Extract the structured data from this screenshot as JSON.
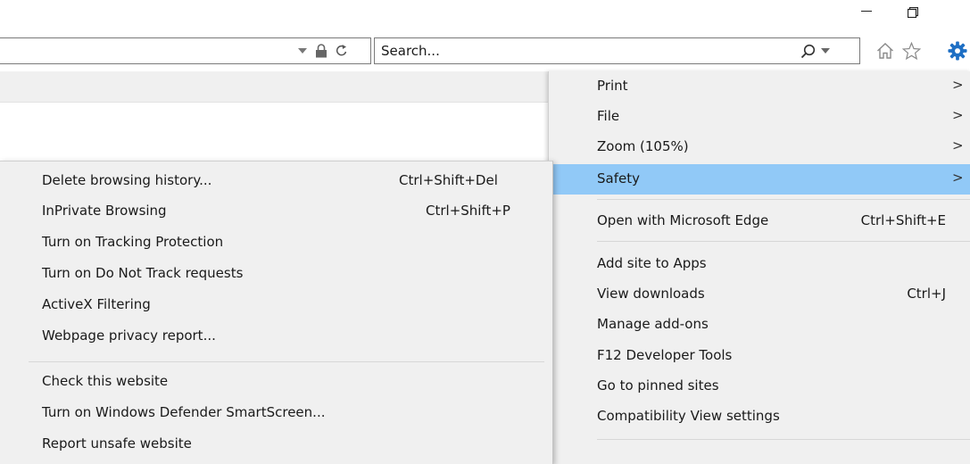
{
  "window": {
    "minimize_icon": "minimize-icon",
    "restore_icon": "restore-icon"
  },
  "address_bar": {
    "dropdown_icon": "chevron-down-icon",
    "lock_icon": "lock-icon",
    "refresh_icon": "refresh-icon"
  },
  "search": {
    "placeholder": "Search...",
    "search_icon": "magnifier-icon",
    "dropdown_icon": "chevron-down-icon"
  },
  "toolbar": {
    "home_icon": "home-icon",
    "favorites_icon": "star-icon",
    "tools_icon": "gear-icon",
    "accent_color": "#1e6fc4"
  },
  "tools_menu": {
    "items": [
      {
        "label": "Print",
        "arrow": ">"
      },
      {
        "label": "File",
        "arrow": ">"
      },
      {
        "label": "Zoom (105%)",
        "arrow": ">"
      },
      {
        "label": "Safety",
        "arrow": ">"
      },
      {
        "label": "Open with Microsoft Edge",
        "shortcut": "Ctrl+Shift+E"
      },
      {
        "label": "Add site to Apps"
      },
      {
        "label": "View downloads",
        "shortcut": "Ctrl+J"
      },
      {
        "label": "Manage add-ons"
      },
      {
        "label": "F12 Developer Tools"
      },
      {
        "label": "Go to pinned sites"
      },
      {
        "label": "Compatibility View settings"
      }
    ],
    "highlight_color": "#91c9f7"
  },
  "safety_menu": {
    "items": [
      {
        "label": "Delete browsing history...",
        "shortcut": "Ctrl+Shift+Del"
      },
      {
        "label": "InPrivate Browsing",
        "shortcut": "Ctrl+Shift+P"
      },
      {
        "label": "Turn on Tracking Protection"
      },
      {
        "label": "Turn on Do Not Track requests"
      },
      {
        "label": "ActiveX Filtering"
      },
      {
        "label": "Webpage privacy report..."
      },
      {
        "label": "Check this website"
      },
      {
        "label": "Turn on Windows Defender SmartScreen..."
      },
      {
        "label": "Report unsafe website"
      }
    ]
  }
}
